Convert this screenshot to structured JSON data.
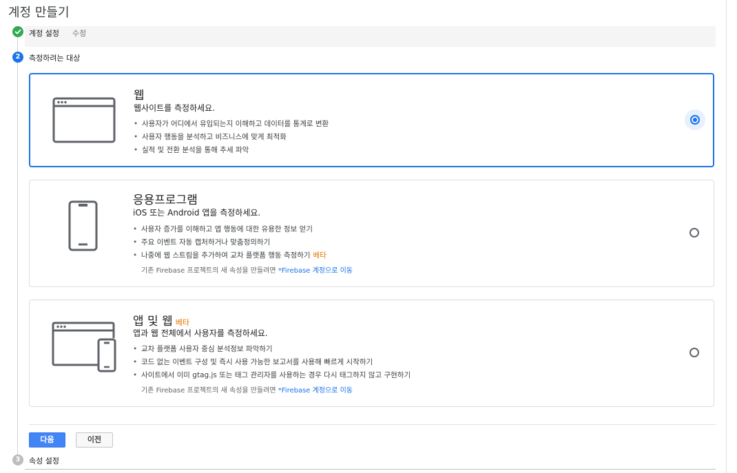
{
  "page": {
    "title": "계정 만들기"
  },
  "steps": [
    {
      "number": "",
      "label": "계정 설정",
      "edit": "수정",
      "status": "complete"
    },
    {
      "number": "2",
      "label": "측정하려는 대상",
      "status": "active"
    },
    {
      "number": "3",
      "label": "속성 설정",
      "status": "pending"
    }
  ],
  "options": [
    {
      "title": "웹",
      "subtitle": "웹사이트를 측정하세요.",
      "bullets": [
        "사용자가 어디에서 유입되는지 이해하고 데이터를 통계로 변환",
        "사용자 행동을 분석하고 비즈니스에 맞게 최적화",
        "실적 및 전환 분석을 통해 추세 파악"
      ],
      "selected": true,
      "icon": "browser-window-icon"
    },
    {
      "title": "응용프로그램",
      "subtitle": "iOS 또는 Android 앱을 측정하세요.",
      "bullets": [
        "사용자 증가를 이해하고 앱 행동에 대한 유용한 정보 얻기",
        "주요 이벤트 자동 캡처하거나 맞춤정의하기",
        "나중에 웹 스트림을 추가하여 교차 플랫폼 행동 측정하기"
      ],
      "bullet_beta": "베타",
      "note_prefix": "기존 Firebase 프로젝트의 새 속성을 만들려면 ",
      "note_link": "*Firebase 계정으로 이동",
      "selected": false,
      "icon": "mobile-phone-icon"
    },
    {
      "title": "앱 및 웹",
      "title_beta": "베타",
      "subtitle": "앱과 웹 전체에서 사용자를 측정하세요.",
      "bullets": [
        "교차 플랫폼 사용자 중심 분석정보 파악하기",
        "코드 없는 이벤트 구성 및 즉시 사용 가능한 보고서를 사용해 빠르게 시작하기",
        "사이트에서 이미 gtag.js 또는 태그 관리자를 사용하는 경우 다시 태그하지 않고 구현하기"
      ],
      "note_prefix": "기존 Firebase 프로젝트의 새 속성을 만들려면 ",
      "note_link": "*Firebase 계정으로 이동",
      "selected": false,
      "icon": "browser-and-phone-icon"
    }
  ],
  "buttons": {
    "next": "다음",
    "previous": "이전"
  },
  "colors": {
    "accent": "#1a73e8",
    "complete": "#34a853",
    "beta": "#e37400",
    "next_button": "#4285f4"
  }
}
